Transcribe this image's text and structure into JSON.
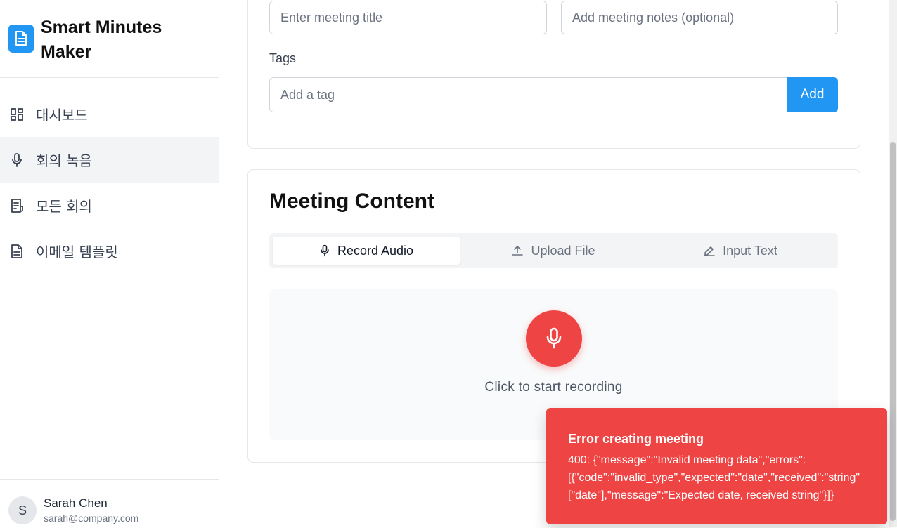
{
  "app": {
    "title": "Smart Minutes Maker"
  },
  "sidebar": {
    "items": [
      {
        "label": "대시보드",
        "icon": "dashboard-icon",
        "active": false
      },
      {
        "label": "회의 녹음",
        "icon": "mic-icon",
        "active": true
      },
      {
        "label": "모든 회의",
        "icon": "list-document-icon",
        "active": false
      },
      {
        "label": "이메일 템플릿",
        "icon": "document-icon",
        "active": false
      }
    ]
  },
  "user": {
    "initial": "S",
    "name": "Sarah Chen",
    "email": "sarah@company.com"
  },
  "form": {
    "title_placeholder": "Enter meeting title",
    "notes_placeholder": "Add meeting notes (optional)",
    "tags_label": "Tags",
    "tag_placeholder": "Add a tag",
    "add_label": "Add"
  },
  "content": {
    "title": "Meeting Content",
    "tabs": [
      {
        "label": "Record Audio",
        "icon": "mic-icon",
        "active": true
      },
      {
        "label": "Upload File",
        "icon": "upload-icon",
        "active": false
      },
      {
        "label": "Input Text",
        "icon": "pencil-icon",
        "active": false
      }
    ],
    "record_hint": "Click to start recording"
  },
  "toast": {
    "title": "Error creating meeting",
    "lines": [
      "400: {\"message\":\"Invalid meeting data\",\"errors\":",
      "[{\"code\":\"invalid_type\",\"expected\":\"date\",\"received\":\"string\"",
      "[\"date\"],\"message\":\"Expected date, received string\"}]}"
    ]
  },
  "colors": {
    "primary": "#2196f3",
    "danger": "#ef4444",
    "active_nav_bg": "#f3f4f6"
  }
}
